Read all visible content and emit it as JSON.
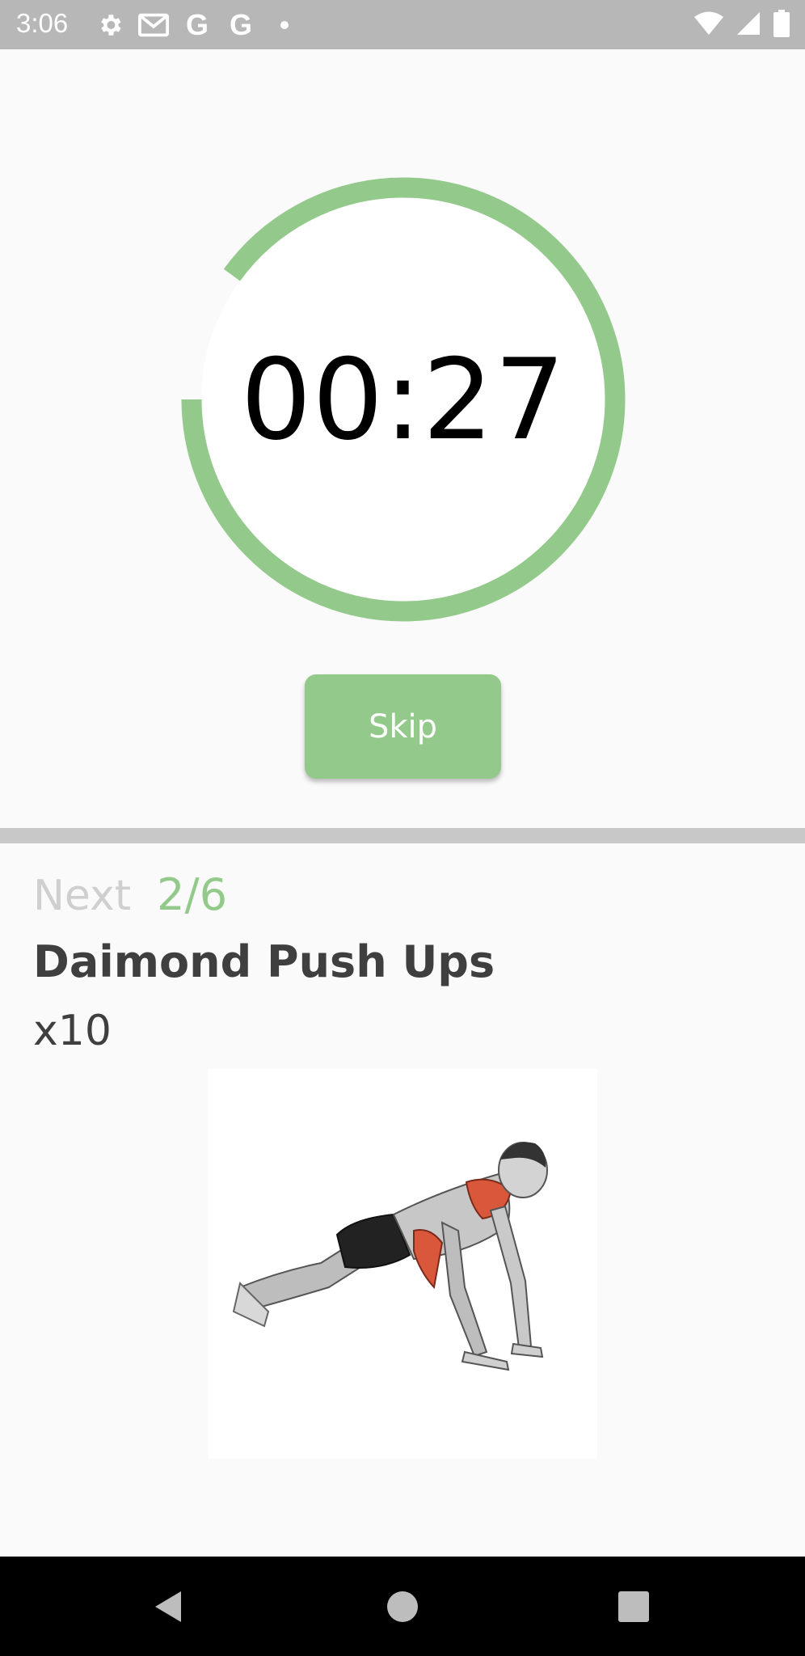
{
  "status_bar": {
    "time": "3:06",
    "left_icons": [
      "settings-icon",
      "gmail-icon",
      "google-icon",
      "google-icon",
      "dot-icon"
    ],
    "google_letter": "G",
    "right_icons": [
      "wifi-icon",
      "signal-icon",
      "battery-icon"
    ]
  },
  "timer": {
    "display": "00:27",
    "progress_remaining": 0.9,
    "ring_color": "#93c98a"
  },
  "skip_button": {
    "label": "Skip",
    "color": "#93c98a"
  },
  "next_up": {
    "label": "Next",
    "progress": "2/6",
    "exercise_name": "Daimond Push Ups",
    "reps": "x10",
    "image_icon": "push-up-illustration"
  },
  "nav_bar": {
    "buttons": [
      "back-icon",
      "home-icon",
      "recents-icon"
    ]
  }
}
